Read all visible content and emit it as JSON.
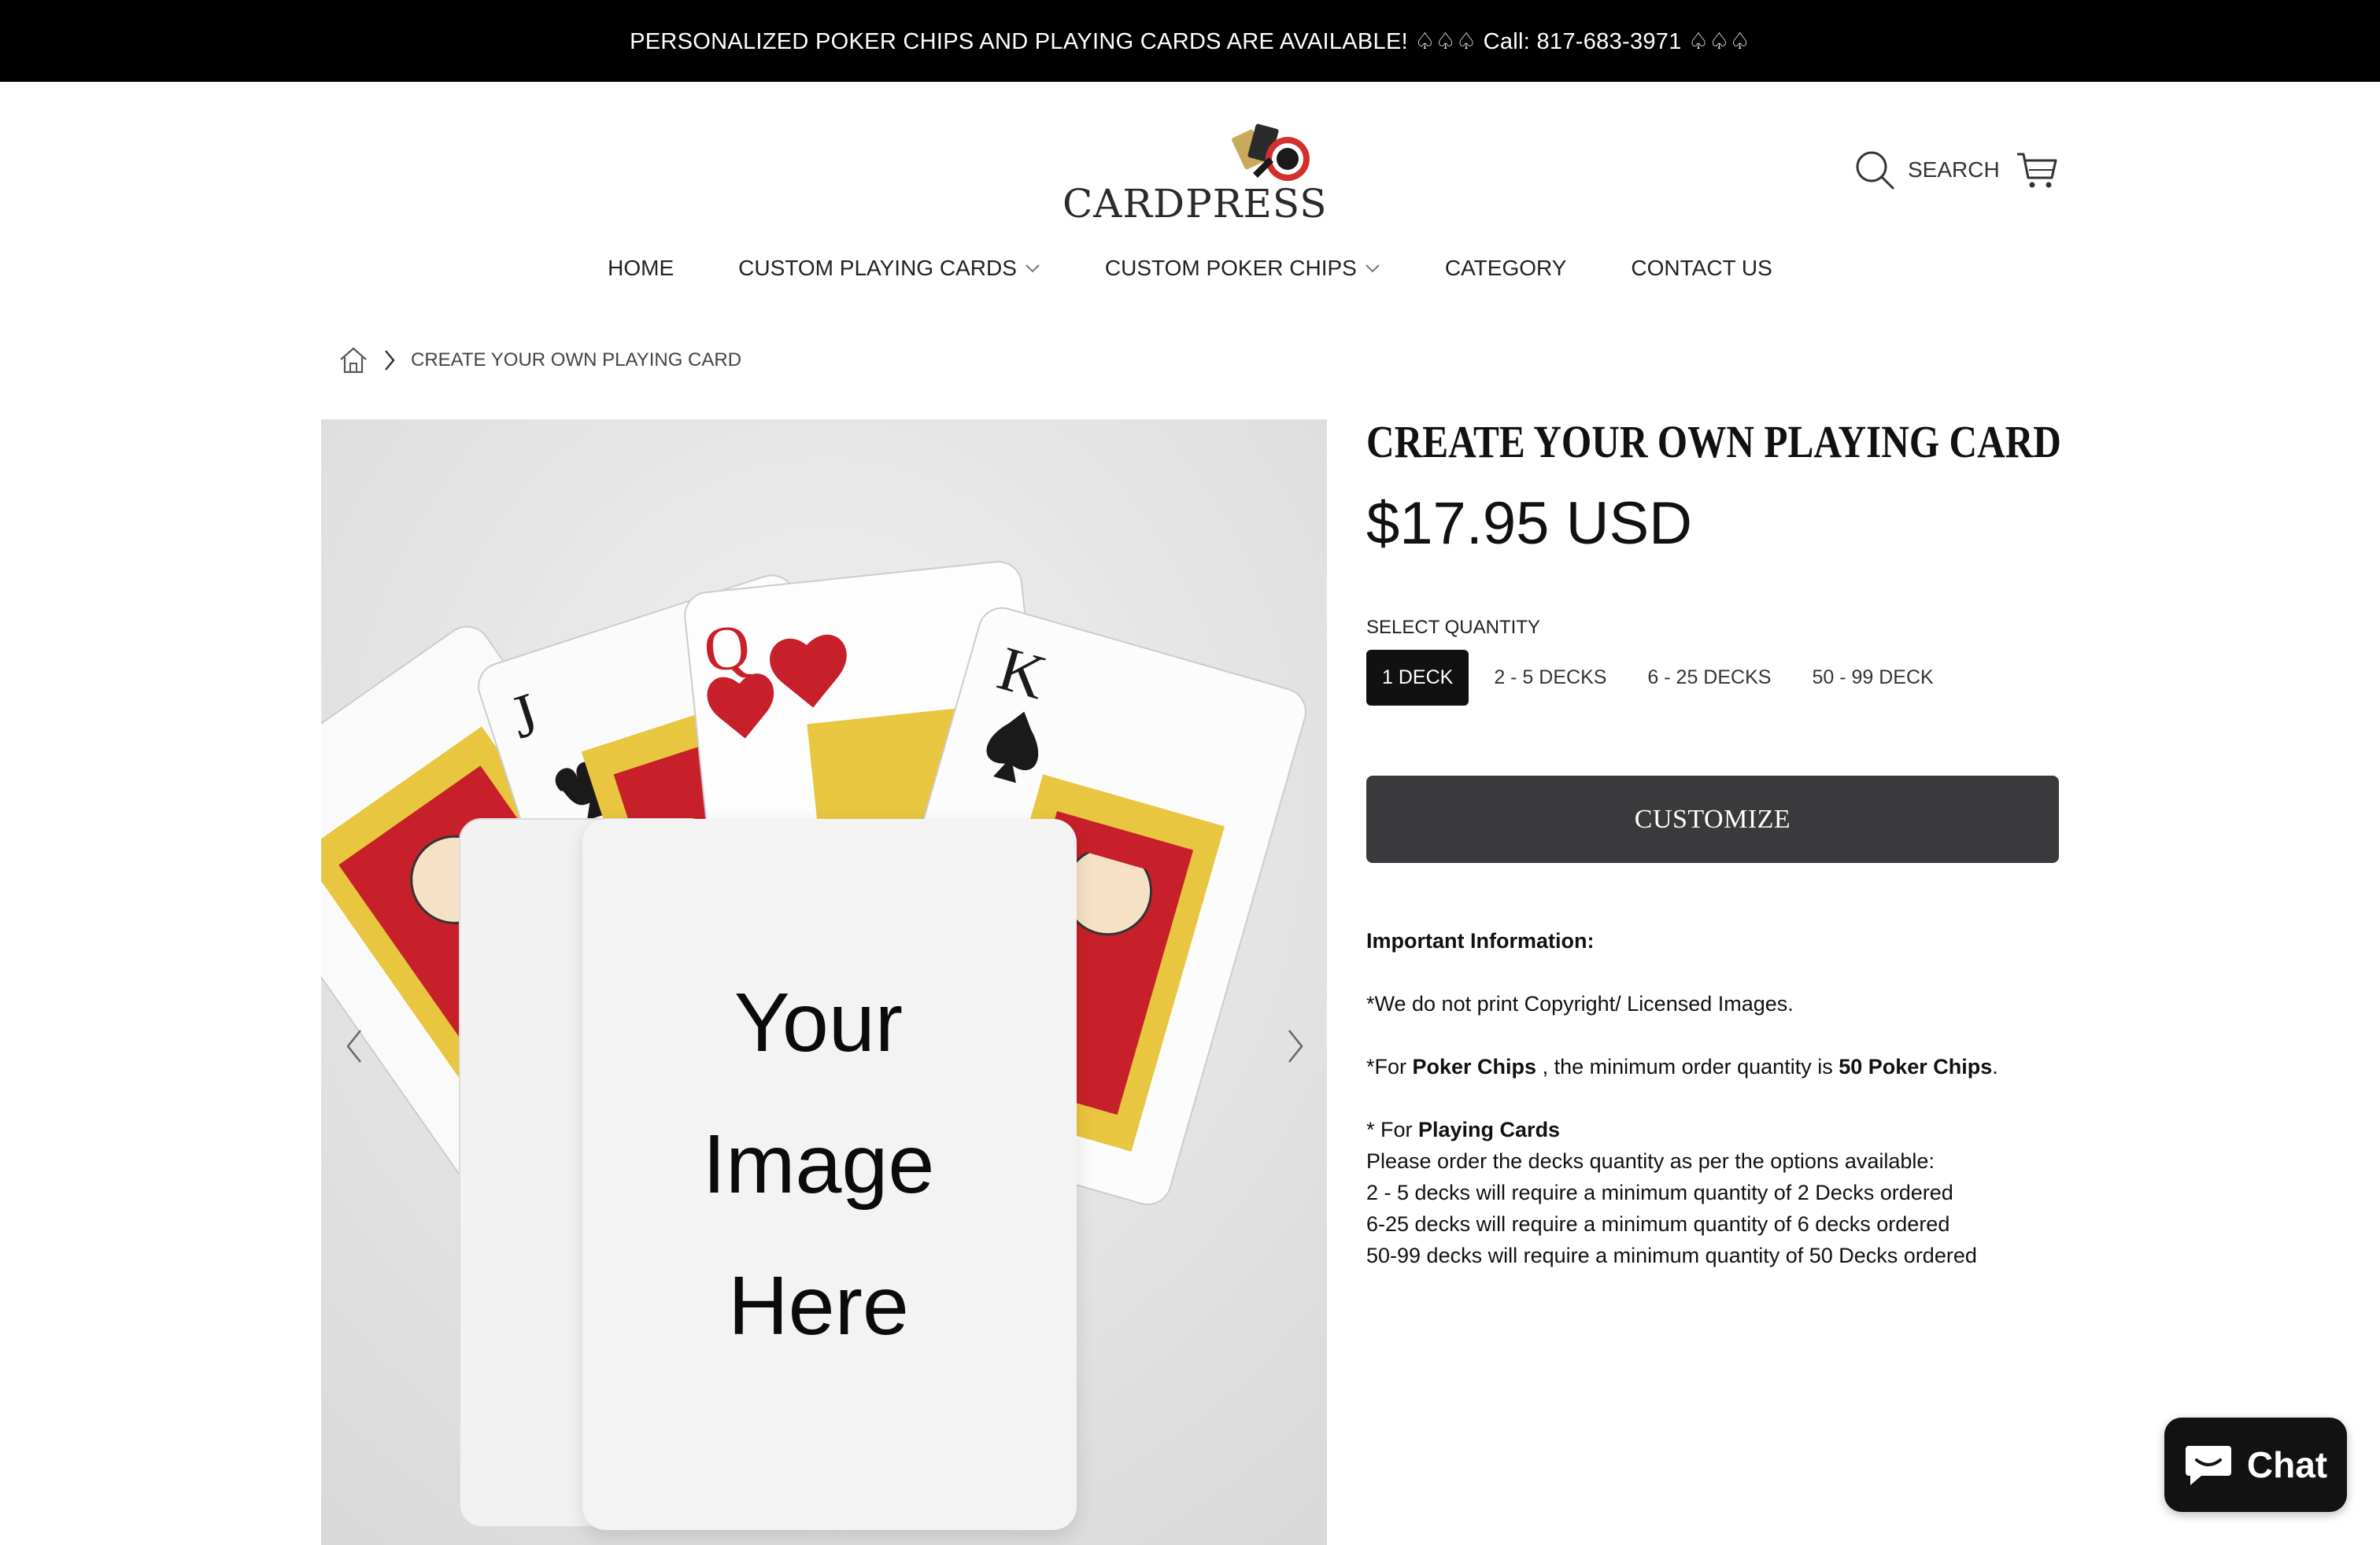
{
  "announcement": "PERSONALIZED POKER CHIPS AND PLAYING CARDS ARE AVAILABLE! ♤♤♤ Call: 817-683-3971 ♤♤♤",
  "brand": {
    "name": "CARDPRESS"
  },
  "header": {
    "search_label": "SEARCH"
  },
  "nav": [
    {
      "label": "HOME",
      "dropdown": false
    },
    {
      "label": "CUSTOM PLAYING CARDS",
      "dropdown": true
    },
    {
      "label": "CUSTOM POKER CHIPS",
      "dropdown": true
    },
    {
      "label": "CATEGORY",
      "dropdown": false
    },
    {
      "label": "CONTACT US",
      "dropdown": false
    }
  ],
  "breadcrumb": {
    "current": "CREATE YOUR OWN PLAYING CARD"
  },
  "media": {
    "placeholder_lines": [
      "Your",
      "Image",
      "Here"
    ],
    "card_ranks": [
      "J",
      "Q",
      "K"
    ]
  },
  "product": {
    "title": "CREATE YOUR OWN PLAYING CARD",
    "price": "$17.95 USD",
    "quantity_label": "SELECT QUANTITY",
    "quantity_options": [
      "1 DECK",
      "2 - 5 DECKS",
      "6 - 25 DECKS",
      "50 - 99 DECK"
    ],
    "selected_quantity": "1 DECK",
    "customize_label": "CUSTOMIZE"
  },
  "info": {
    "heading": "Important Information:",
    "copyright_note": "*We do not print Copyright/ Licensed Images.",
    "chips_prefix": "*For ",
    "chips_bold": "Poker Chips",
    "chips_middle": " , the minimum order quantity is ",
    "chips_qty": "50 Poker Chips",
    "chips_suffix": ".",
    "cards_prefix": "* For ",
    "cards_bold": "Playing Cards",
    "cards_lines": [
      "Please order the decks quantity as per the options available:",
      "2 - 5 decks will require a minimum quantity of 2 Decks ordered",
      "6-25 decks will require a minimum quantity of 6 decks ordered",
      "50-99 decks will require a minimum quantity of 50 Decks ordered"
    ]
  },
  "chat": {
    "label": "Chat"
  },
  "colors": {
    "announce_bg": "#000000",
    "button_bg": "#3a3a3d",
    "selected_bg": "#111111",
    "suit_red": "#c8202a"
  }
}
